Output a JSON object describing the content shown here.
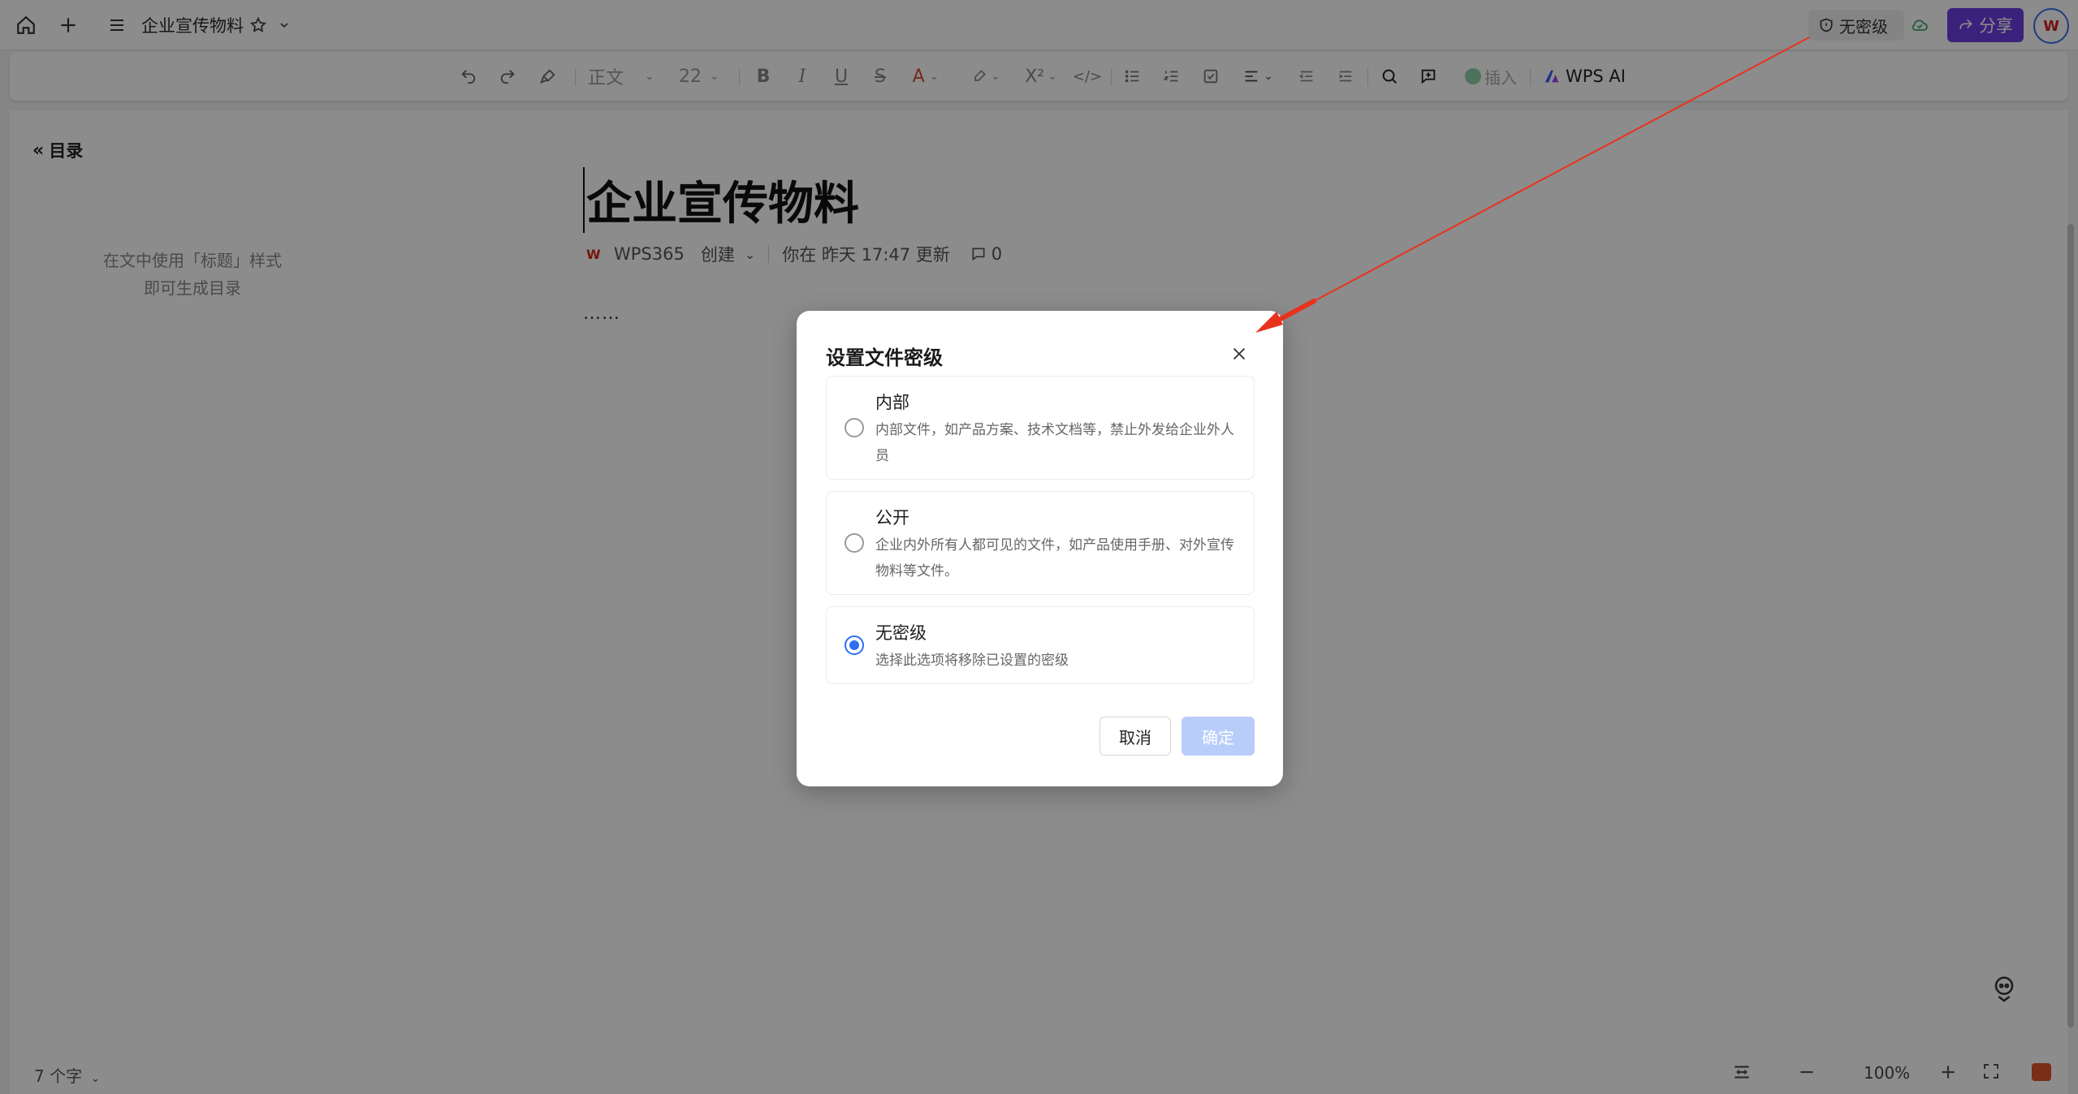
{
  "topbar": {
    "doc_title": "企业宣传物料",
    "security_level": "无密级",
    "share_label": "分享"
  },
  "toolbar": {
    "style_label": "正文",
    "font_size": "22",
    "insert_label": "插入",
    "ai_label": "WPS AI"
  },
  "toc": {
    "header": "目录",
    "hint_line1": "在文中使用「标题」样式",
    "hint_line2": "即可生成目录"
  },
  "document": {
    "title": "企业宣传物料",
    "brand": "WPS365",
    "created_label": "创建",
    "updated_text": "你在 昨天 17:47 更新",
    "comment_count": "0",
    "body": "……"
  },
  "statusbar": {
    "word_count": "7 个字",
    "zoom": "100%"
  },
  "dialog": {
    "title": "设置文件密级",
    "options": [
      {
        "title": "内部",
        "desc": "内部文件，如产品方案、技术文档等，禁止外发给企业外人员",
        "selected": false
      },
      {
        "title": "公开",
        "desc": "企业内外所有人都可见的文件，如产品使用手册、对外宣传物料等文件。",
        "selected": false
      },
      {
        "title": "无密级",
        "desc": "选择此选项将移除已设置的密级",
        "selected": true
      }
    ],
    "cancel_label": "取消",
    "ok_label": "确定"
  },
  "colors": {
    "accent": "#2f6ef0",
    "share_button": "#6c3de0",
    "ok_button_disabled": "#b8cdfa",
    "annotation_arrow": "#e8321e"
  }
}
